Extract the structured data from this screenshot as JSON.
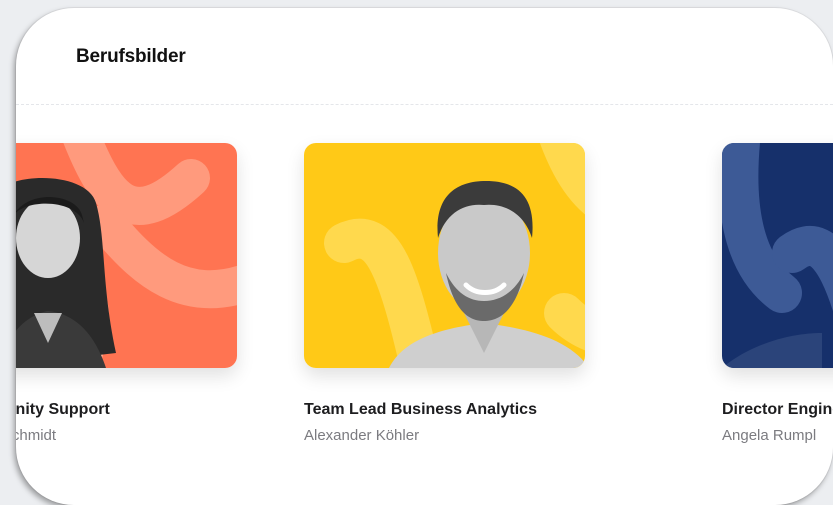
{
  "section": {
    "title": "Berufsbilder"
  },
  "cards": [
    {
      "role": "Community Support",
      "person": "Nicole Schmidt",
      "color": "#ff7452",
      "pattern": "#ff9a7d"
    },
    {
      "role": "Team Lead Business Analytics",
      "person": "Alexander Köhler",
      "color": "#ffc917",
      "pattern": "#ffdb5a"
    },
    {
      "role": "Director Engineering",
      "person": "Angela Rumpl",
      "color": "#16306b",
      "pattern": "#3d5a96"
    }
  ]
}
